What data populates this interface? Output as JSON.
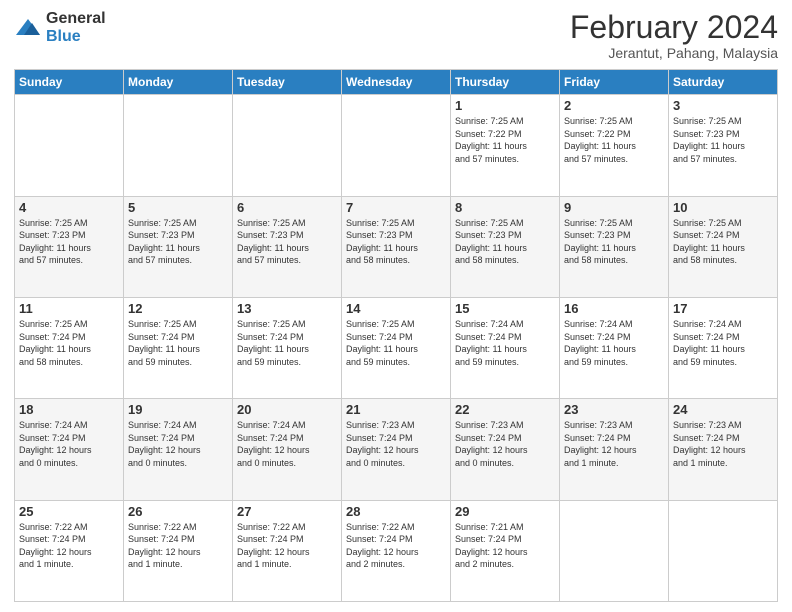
{
  "logo": {
    "general": "General",
    "blue": "Blue"
  },
  "title": "February 2024",
  "subtitle": "Jerantut, Pahang, Malaysia",
  "weekdays": [
    "Sunday",
    "Monday",
    "Tuesday",
    "Wednesday",
    "Thursday",
    "Friday",
    "Saturday"
  ],
  "weeks": [
    [
      {
        "day": "",
        "info": ""
      },
      {
        "day": "",
        "info": ""
      },
      {
        "day": "",
        "info": ""
      },
      {
        "day": "",
        "info": ""
      },
      {
        "day": "1",
        "info": "Sunrise: 7:25 AM\nSunset: 7:22 PM\nDaylight: 11 hours\nand 57 minutes."
      },
      {
        "day": "2",
        "info": "Sunrise: 7:25 AM\nSunset: 7:22 PM\nDaylight: 11 hours\nand 57 minutes."
      },
      {
        "day": "3",
        "info": "Sunrise: 7:25 AM\nSunset: 7:23 PM\nDaylight: 11 hours\nand 57 minutes."
      }
    ],
    [
      {
        "day": "4",
        "info": "Sunrise: 7:25 AM\nSunset: 7:23 PM\nDaylight: 11 hours\nand 57 minutes."
      },
      {
        "day": "5",
        "info": "Sunrise: 7:25 AM\nSunset: 7:23 PM\nDaylight: 11 hours\nand 57 minutes."
      },
      {
        "day": "6",
        "info": "Sunrise: 7:25 AM\nSunset: 7:23 PM\nDaylight: 11 hours\nand 57 minutes."
      },
      {
        "day": "7",
        "info": "Sunrise: 7:25 AM\nSunset: 7:23 PM\nDaylight: 11 hours\nand 58 minutes."
      },
      {
        "day": "8",
        "info": "Sunrise: 7:25 AM\nSunset: 7:23 PM\nDaylight: 11 hours\nand 58 minutes."
      },
      {
        "day": "9",
        "info": "Sunrise: 7:25 AM\nSunset: 7:23 PM\nDaylight: 11 hours\nand 58 minutes."
      },
      {
        "day": "10",
        "info": "Sunrise: 7:25 AM\nSunset: 7:24 PM\nDaylight: 11 hours\nand 58 minutes."
      }
    ],
    [
      {
        "day": "11",
        "info": "Sunrise: 7:25 AM\nSunset: 7:24 PM\nDaylight: 11 hours\nand 58 minutes."
      },
      {
        "day": "12",
        "info": "Sunrise: 7:25 AM\nSunset: 7:24 PM\nDaylight: 11 hours\nand 59 minutes."
      },
      {
        "day": "13",
        "info": "Sunrise: 7:25 AM\nSunset: 7:24 PM\nDaylight: 11 hours\nand 59 minutes."
      },
      {
        "day": "14",
        "info": "Sunrise: 7:25 AM\nSunset: 7:24 PM\nDaylight: 11 hours\nand 59 minutes."
      },
      {
        "day": "15",
        "info": "Sunrise: 7:24 AM\nSunset: 7:24 PM\nDaylight: 11 hours\nand 59 minutes."
      },
      {
        "day": "16",
        "info": "Sunrise: 7:24 AM\nSunset: 7:24 PM\nDaylight: 11 hours\nand 59 minutes."
      },
      {
        "day": "17",
        "info": "Sunrise: 7:24 AM\nSunset: 7:24 PM\nDaylight: 11 hours\nand 59 minutes."
      }
    ],
    [
      {
        "day": "18",
        "info": "Sunrise: 7:24 AM\nSunset: 7:24 PM\nDaylight: 12 hours\nand 0 minutes."
      },
      {
        "day": "19",
        "info": "Sunrise: 7:24 AM\nSunset: 7:24 PM\nDaylight: 12 hours\nand 0 minutes."
      },
      {
        "day": "20",
        "info": "Sunrise: 7:24 AM\nSunset: 7:24 PM\nDaylight: 12 hours\nand 0 minutes."
      },
      {
        "day": "21",
        "info": "Sunrise: 7:23 AM\nSunset: 7:24 PM\nDaylight: 12 hours\nand 0 minutes."
      },
      {
        "day": "22",
        "info": "Sunrise: 7:23 AM\nSunset: 7:24 PM\nDaylight: 12 hours\nand 0 minutes."
      },
      {
        "day": "23",
        "info": "Sunrise: 7:23 AM\nSunset: 7:24 PM\nDaylight: 12 hours\nand 1 minute."
      },
      {
        "day": "24",
        "info": "Sunrise: 7:23 AM\nSunset: 7:24 PM\nDaylight: 12 hours\nand 1 minute."
      }
    ],
    [
      {
        "day": "25",
        "info": "Sunrise: 7:22 AM\nSunset: 7:24 PM\nDaylight: 12 hours\nand 1 minute."
      },
      {
        "day": "26",
        "info": "Sunrise: 7:22 AM\nSunset: 7:24 PM\nDaylight: 12 hours\nand 1 minute."
      },
      {
        "day": "27",
        "info": "Sunrise: 7:22 AM\nSunset: 7:24 PM\nDaylight: 12 hours\nand 1 minute."
      },
      {
        "day": "28",
        "info": "Sunrise: 7:22 AM\nSunset: 7:24 PM\nDaylight: 12 hours\nand 2 minutes."
      },
      {
        "day": "29",
        "info": "Sunrise: 7:21 AM\nSunset: 7:24 PM\nDaylight: 12 hours\nand 2 minutes."
      },
      {
        "day": "",
        "info": ""
      },
      {
        "day": "",
        "info": ""
      }
    ]
  ]
}
